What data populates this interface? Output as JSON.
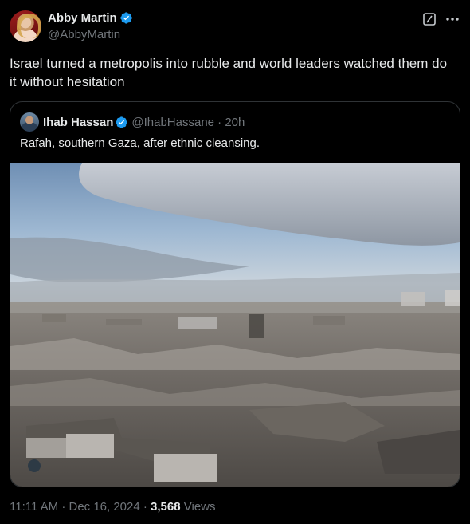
{
  "author": {
    "display_name": "Abby Martin",
    "handle": "@AbbyMartin",
    "verified_icon": "verified-badge-icon",
    "verified_color": "#1d9bf0"
  },
  "header_actions": {
    "grok_icon": "grok-icon",
    "more_icon": "more-options-icon"
  },
  "tweet": {
    "text": "Israel turned a metropolis into rubble and world leaders watched them do it without hesitation"
  },
  "quoted_tweet": {
    "display_name": "Ihab Hassan",
    "handle_time": "@IhabHassane · 20h",
    "text": "Rafah, southern Gaza, after ethnic cleansing.",
    "image_icon": "photo-rubble-landscape"
  },
  "meta": {
    "time_date": "11:11 AM · Dec 16, 2024 · ",
    "views_count": "3,568",
    "views_label": " Views"
  },
  "colors": {
    "background": "#000000",
    "text_primary": "#e7e9ea",
    "text_secondary": "#71767b",
    "border": "#2f3336"
  }
}
